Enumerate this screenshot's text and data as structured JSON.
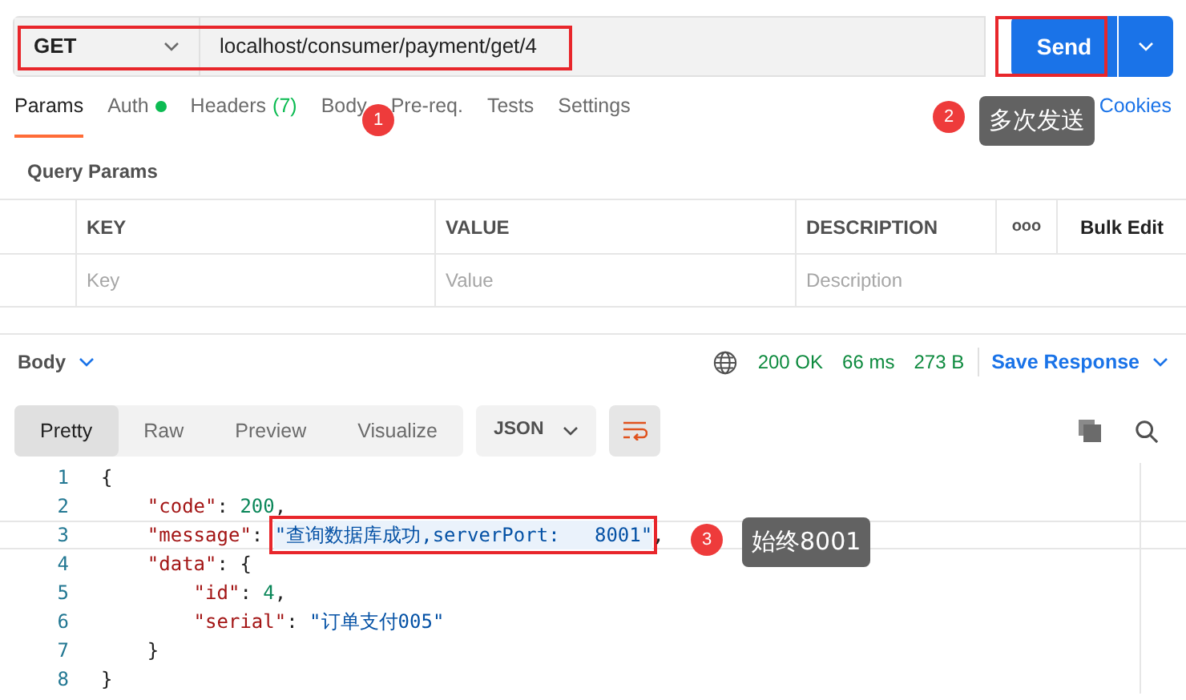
{
  "request": {
    "method": "GET",
    "url": "localhost/consumer/payment/get/4",
    "outlined": true
  },
  "send": {
    "label": "Send",
    "outlined": true
  },
  "tabs": [
    {
      "label": "Params",
      "selected": true
    },
    {
      "label": "Auth",
      "selected": false,
      "dot": true
    },
    {
      "label": "Headers",
      "selected": false,
      "count": "(7)"
    },
    {
      "label": "Body",
      "selected": false
    },
    {
      "label": "Pre-req.",
      "selected": false
    },
    {
      "label": "Tests",
      "selected": false
    },
    {
      "label": "Settings",
      "selected": false
    }
  ],
  "cookies": "Cookies",
  "query_title": "Query Params",
  "params_table": {
    "columns": [
      "KEY",
      "VALUE",
      "DESCRIPTION"
    ],
    "more": "ooo",
    "bulk_edit": "Bulk Edit",
    "placeholders": [
      "Key",
      "Value",
      "Description"
    ]
  },
  "response_bar": {
    "section": "Body",
    "status": "200 OK",
    "time": "66 ms",
    "size": "273 B",
    "save": "Save Response"
  },
  "view_tabs": [
    {
      "label": "Pretty",
      "selected": true
    },
    {
      "label": "Raw",
      "selected": false
    },
    {
      "label": "Preview",
      "selected": false
    },
    {
      "label": "Visualize",
      "selected": false
    }
  ],
  "format": "JSON",
  "code_lines": [
    {
      "number": "1",
      "tokens": [
        {
          "kind": "punct",
          "text": "{"
        }
      ]
    },
    {
      "number": "2",
      "tokens": [
        {
          "kind": "key",
          "text": "    \"code\""
        },
        {
          "kind": "punct",
          "text": ": "
        },
        {
          "kind": "number",
          "text": "200"
        },
        {
          "kind": "punct",
          "text": ","
        }
      ]
    },
    {
      "number": "3",
      "current": true,
      "tokens": [
        {
          "kind": "key",
          "text": "    \"message\""
        },
        {
          "kind": "punct",
          "text": ": "
        },
        {
          "kind": "string",
          "text": "\"查询数据库成功,serverPort:   8001\"",
          "outlined": true
        },
        {
          "kind": "punct",
          "text": ","
        }
      ]
    },
    {
      "number": "4",
      "tokens": [
        {
          "kind": "key",
          "text": "    \"data\""
        },
        {
          "kind": "punct",
          "text": ": {"
        }
      ]
    },
    {
      "number": "5",
      "tokens": [
        {
          "kind": "key",
          "text": "        \"id\""
        },
        {
          "kind": "punct",
          "text": ": "
        },
        {
          "kind": "number",
          "text": "4"
        },
        {
          "kind": "punct",
          "text": ","
        }
      ]
    },
    {
      "number": "6",
      "tokens": [
        {
          "kind": "key",
          "text": "        \"serial\""
        },
        {
          "kind": "punct",
          "text": ": "
        },
        {
          "kind": "string",
          "text": "\"订单支付005\""
        }
      ]
    },
    {
      "number": "7",
      "tokens": [
        {
          "kind": "punct",
          "text": "    }"
        }
      ]
    },
    {
      "number": "8",
      "tokens": [
        {
          "kind": "punct",
          "text": "}"
        }
      ]
    }
  ],
  "callouts": [
    {
      "number": "1"
    },
    {
      "number": "2",
      "note": "多次发送"
    },
    {
      "number": "3",
      "note": "始终8001"
    }
  ]
}
